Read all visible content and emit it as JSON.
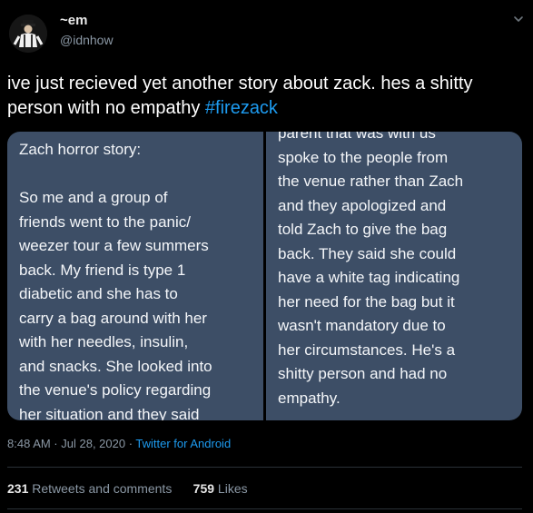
{
  "author": {
    "display_name": "~em",
    "handle": "@idnhow",
    "avatar_icon": "person-photo-avatar"
  },
  "tweet": {
    "text_before": "ive just recieved yet another story about zack. hes a shitty person with no empathy ",
    "hashtag": "#firezack"
  },
  "media": {
    "left_text": "Zach horror story:\n\nSo me and a group of\nfriends went to the panic/\nweezer tour a few summers\nback. My friend is type 1\ndiabetic and she has to\ncarry a bag around with her\nwith her needles, insulin,\nand snacks. She looked into\nthe venue's policy regarding\nher situation and they said",
    "right_text": "parent that was with us\nspoke to the people from\nthe venue rather than Zach\nand they apologized and\ntold Zach to give the bag\nback. They said she could\nhave a white tag indicating\nher need for the bag but it\nwasn't mandatory due to\nher circumstances. He's a\nshitty person and had no\nempathy."
  },
  "meta": {
    "timestamp": "8:48 AM · Jul 28, 2020 · ",
    "source": "Twitter for Android"
  },
  "stats": {
    "retweets_count": "231",
    "retweets_label": " Retweets and comments",
    "likes_count": "759",
    "likes_label": " Likes"
  },
  "colors": {
    "background": "#000000",
    "link": "#1d9bf0",
    "secondary_text": "#8b98a5",
    "panel": "#3d4e66"
  }
}
